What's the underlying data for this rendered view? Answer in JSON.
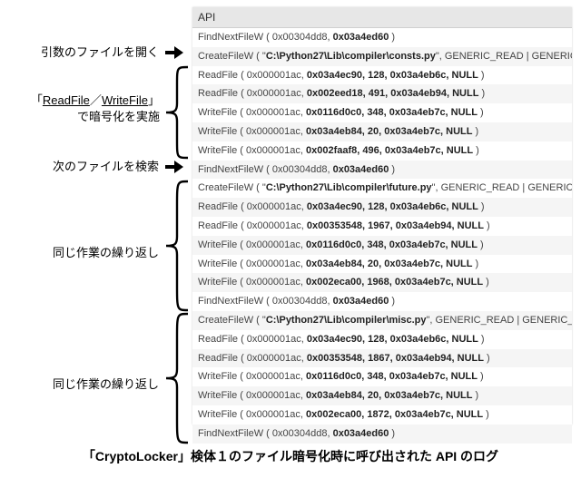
{
  "panel": {
    "header": "API"
  },
  "logs": [
    {
      "fn": "FindNextFileW",
      "args": "0x00304dd8, 0x03a4ed60"
    },
    {
      "fn": "CreateFileW",
      "args": "\"C:\\Python27\\Lib\\compiler\\consts.py\", GENERIC_READ | GENERIC_"
    },
    {
      "fn": "ReadFile",
      "args": "0x000001ac, 0x03a4ec90, 128, 0x03a4eb6c, NULL"
    },
    {
      "fn": "ReadFile",
      "args": "0x000001ac, 0x002eed18, 491, 0x03a4eb94, NULL"
    },
    {
      "fn": "WriteFile",
      "args": "0x000001ac, 0x0116d0c0, 348, 0x03a4eb7c, NULL"
    },
    {
      "fn": "WriteFile",
      "args": "0x000001ac, 0x03a4eb84, 20, 0x03a4eb7c, NULL"
    },
    {
      "fn": "WriteFile",
      "args": "0x000001ac, 0x002faaf8, 496, 0x03a4eb7c, NULL"
    },
    {
      "fn": "FindNextFileW",
      "args": "0x00304dd8, 0x03a4ed60"
    },
    {
      "fn": "CreateFileW",
      "args": "\"C:\\Python27\\Lib\\compiler\\future.py\", GENERIC_READ | GENERIC_"
    },
    {
      "fn": "ReadFile",
      "args": "0x000001ac, 0x03a4ec90, 128, 0x03a4eb6c, NULL"
    },
    {
      "fn": "ReadFile",
      "args": "0x000001ac, 0x00353548, 1967, 0x03a4eb94, NULL"
    },
    {
      "fn": "WriteFile",
      "args": "0x000001ac, 0x0116d0c0, 348, 0x03a4eb7c, NULL"
    },
    {
      "fn": "WriteFile",
      "args": "0x000001ac, 0x03a4eb84, 20, 0x03a4eb7c, NULL"
    },
    {
      "fn": "WriteFile",
      "args": "0x000001ac, 0x002eca00, 1968, 0x03a4eb7c, NULL"
    },
    {
      "fn": "FindNextFileW",
      "args": "0x00304dd8, 0x03a4ed60"
    },
    {
      "fn": "CreateFileW",
      "args": "\"C:\\Python27\\Lib\\compiler\\misc.py\", GENERIC_READ | GENERIC_W"
    },
    {
      "fn": "ReadFile",
      "args": "0x000001ac, 0x03a4ec90, 128, 0x03a4eb6c, NULL"
    },
    {
      "fn": "ReadFile",
      "args": "0x000001ac, 0x00353548, 1867, 0x03a4eb94, NULL"
    },
    {
      "fn": "WriteFile",
      "args": "0x000001ac, 0x0116d0c0, 348, 0x03a4eb7c, NULL"
    },
    {
      "fn": "WriteFile",
      "args": "0x000001ac, 0x03a4eb84, 20, 0x03a4eb7c, NULL"
    },
    {
      "fn": "WriteFile",
      "args": "0x000001ac, 0x002eca00, 1872, 0x03a4eb7c, NULL"
    },
    {
      "fn": "FindNextFileW",
      "args": "0x00304dd8, 0x03a4ed60"
    }
  ],
  "labels": {
    "open_arg_file": "引数のファイルを開く",
    "readwrite_prefix": "「",
    "readwrite_read": "ReadFile",
    "readwrite_slash": "／",
    "readwrite_write": "WriteFile",
    "readwrite_suffix": "」",
    "readwrite_line2": "で暗号化を実施",
    "next_file": "次のファイルを検索",
    "repeat": "同じ作業の繰り返し"
  },
  "caption": "「CryptoLocker」検体１のファイル暗号化時に呼び出された API のログ"
}
